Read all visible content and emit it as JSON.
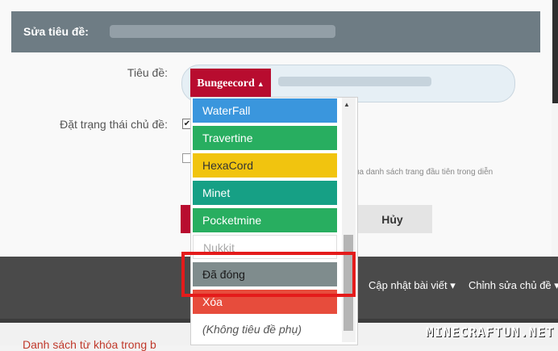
{
  "modal": {
    "title": "Sửa tiêu đề:",
    "labels": {
      "title": "Tiêu đề:",
      "status": "Đặt trạng thái chủ đề:"
    },
    "prefix_button": "Bungeecord",
    "cancel_button": "Hủy",
    "hint_text": "ủa danh sách trang đầu tiên trong diễn"
  },
  "prefix_dropdown": {
    "options": [
      {
        "label": "WaterFall",
        "color": "#3a96dd"
      },
      {
        "label": "Travertine",
        "color": "#28ae60"
      },
      {
        "label": "HexaCord",
        "color": "#f1c40f"
      },
      {
        "label": "Minet",
        "color": "#16a085"
      },
      {
        "label": "Pocketmine",
        "color": "#28ae60"
      },
      {
        "label": "Nukkit",
        "color": "#ffffff"
      },
      {
        "label": "Đã đóng",
        "color": "#7f8c8d"
      },
      {
        "label": "Xóa",
        "color": "#e74c3c"
      },
      {
        "label": "(Không tiêu đề phụ)",
        "color": "#ffffff"
      }
    ]
  },
  "page_menu": {
    "update_post": "Cập nhật bài viết",
    "edit_thread": "Chỉnh sửa chủ đề"
  },
  "page_text": "Danh sách từ khóa trong b",
  "watermark": "MINECRAFTUN.NET",
  "colors": {
    "accent": "#b80c2f",
    "header": "#6e7c84",
    "highlight_box": "#e41b1b"
  }
}
